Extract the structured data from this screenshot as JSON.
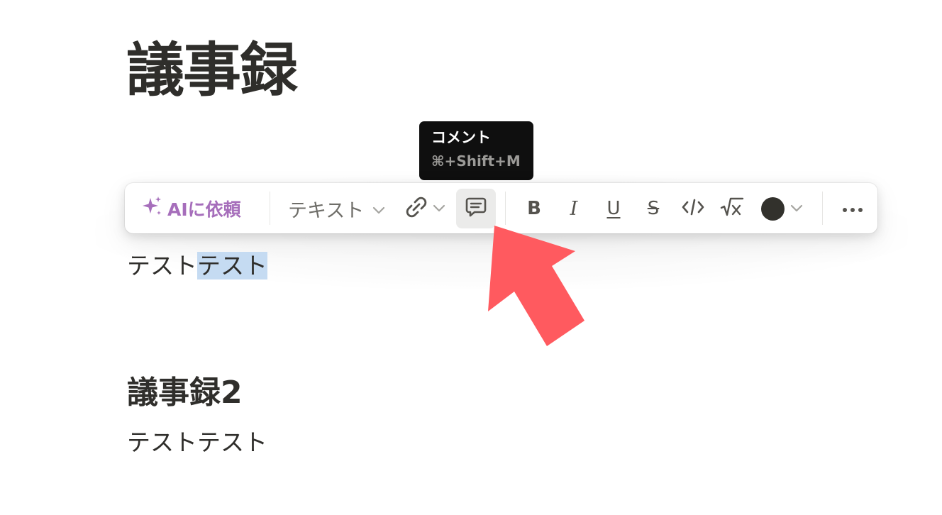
{
  "page": {
    "title": "議事録",
    "block1_plain": "テスト",
    "block1_selected": "テスト",
    "heading2": "議事録2",
    "block2": "テストテスト"
  },
  "tooltip": {
    "title": "コメント",
    "shortcut": "⌘+Shift+M"
  },
  "toolbar": {
    "ai_label": "AIに依頼",
    "text_type_label": "テキスト",
    "bold_label": "B",
    "italic_label": "I",
    "underline_label": "U",
    "strike_label": "S",
    "current_color": "#32312c",
    "icons": [
      "sparkle-icon",
      "chevron-down-icon",
      "link-icon",
      "comment-icon",
      "code-icon",
      "equation-icon",
      "more-icon"
    ]
  },
  "colors": {
    "ai_accent": "#a66ebb",
    "selection": "#c5dbf2",
    "arrow": "#ff5a5f",
    "tooltip_bg": "#0f0f0f"
  }
}
